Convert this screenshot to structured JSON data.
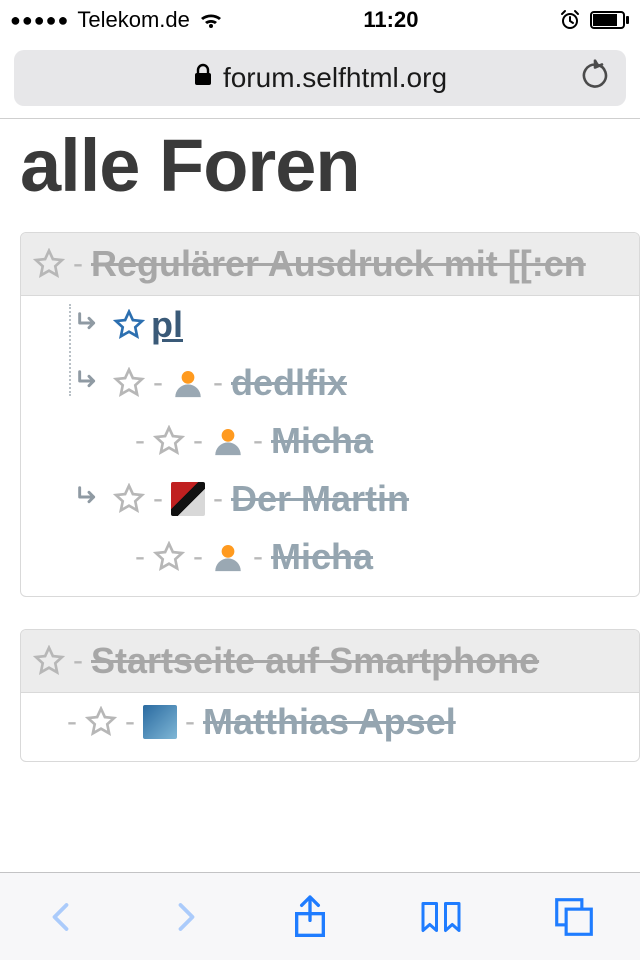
{
  "statusbar": {
    "carrier": "Telekom.de",
    "time": "11:20"
  },
  "urlbar": {
    "url": "forum.selfhtml.org"
  },
  "page": {
    "title": "alle Foren"
  },
  "threads": [
    {
      "title": "Regulärer Ausdruck mit [[:cn",
      "replies": [
        {
          "author": "pl"
        },
        {
          "author": "dedlfix"
        },
        {
          "author": "Micha"
        },
        {
          "author": "Der Martin"
        },
        {
          "author": "Micha"
        }
      ]
    },
    {
      "title": "Startseite auf Smartphone",
      "replies": [
        {
          "author": "Matthias Apsel"
        }
      ]
    }
  ],
  "colors": {
    "star_gray": "#b7b7b7",
    "star_blue": "#2c6fb0",
    "link_read": "#95a5b0",
    "link_alive": "#3a5a78",
    "ios_blue": "#1f7cff"
  }
}
